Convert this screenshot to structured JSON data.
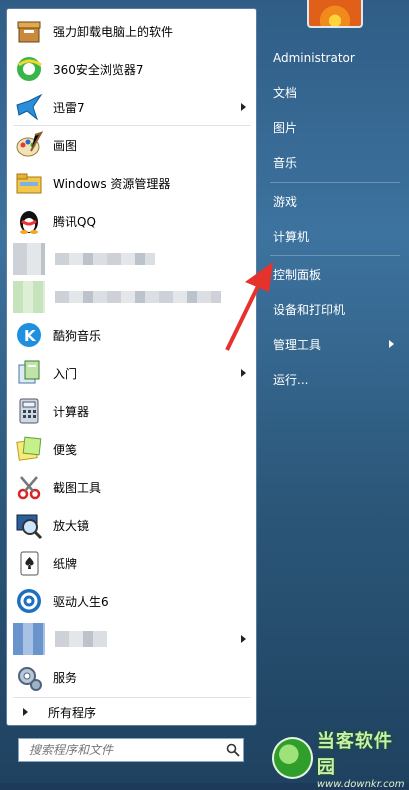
{
  "pinned": [
    {
      "label": "强力卸载电脑上的软件",
      "icon": "uninstall-icon",
      "arrow": false
    },
    {
      "label": "360安全浏览器7",
      "icon": "browser-360-icon",
      "arrow": false
    },
    {
      "label": "迅雷7",
      "icon": "thunder-bird-icon",
      "arrow": true
    }
  ],
  "recent": [
    {
      "label": "画图",
      "icon": "paint-icon",
      "arrow": false
    },
    {
      "label": "Windows 资源管理器",
      "icon": "explorer-folder-icon",
      "arrow": false
    },
    {
      "label": "腾讯QQ",
      "icon": "qq-penguin-icon",
      "arrow": false
    },
    {
      "label": "",
      "icon": "blurred-icon",
      "arrow": false
    },
    {
      "label": "",
      "icon": "blurred-icon",
      "arrow": false
    },
    {
      "label": "酷狗音乐",
      "icon": "kugou-icon",
      "arrow": false
    },
    {
      "label": "入门",
      "icon": "getting-started-icon",
      "arrow": true
    },
    {
      "label": "计算器",
      "icon": "calculator-icon",
      "arrow": false
    },
    {
      "label": "便笺",
      "icon": "sticky-notes-icon",
      "arrow": false
    },
    {
      "label": "截图工具",
      "icon": "snipping-tool-icon",
      "arrow": false
    },
    {
      "label": "放大镜",
      "icon": "magnifier-icon",
      "arrow": false
    },
    {
      "label": "纸牌",
      "icon": "solitaire-icon",
      "arrow": false
    },
    {
      "label": "驱动人生6",
      "icon": "driver-life-icon",
      "arrow": false
    },
    {
      "label": "",
      "icon": "blurred-icon",
      "arrow": true
    },
    {
      "label": "服务",
      "icon": "services-gear-icon",
      "arrow": false
    }
  ],
  "all_programs": "所有程序",
  "search": {
    "placeholder": "搜索程序和文件"
  },
  "right_menu": [
    {
      "label": "Administrator",
      "arrow": false
    },
    {
      "label": "文档",
      "arrow": false
    },
    {
      "label": "图片",
      "arrow": false
    },
    {
      "label": "音乐",
      "arrow": false
    },
    {
      "label": "游戏",
      "arrow": false
    },
    {
      "label": "计算机",
      "arrow": false
    },
    {
      "label": "控制面板",
      "arrow": false
    },
    {
      "label": "设备和打印机",
      "arrow": false
    },
    {
      "label": "管理工具",
      "arrow": true
    },
    {
      "label": "运行...",
      "arrow": false
    }
  ],
  "watermark": {
    "title": "当客软件园",
    "url": "www.downkr.com"
  },
  "colors": {
    "accent_red": "#e5322d",
    "panel_blue": "#2f5d86"
  }
}
